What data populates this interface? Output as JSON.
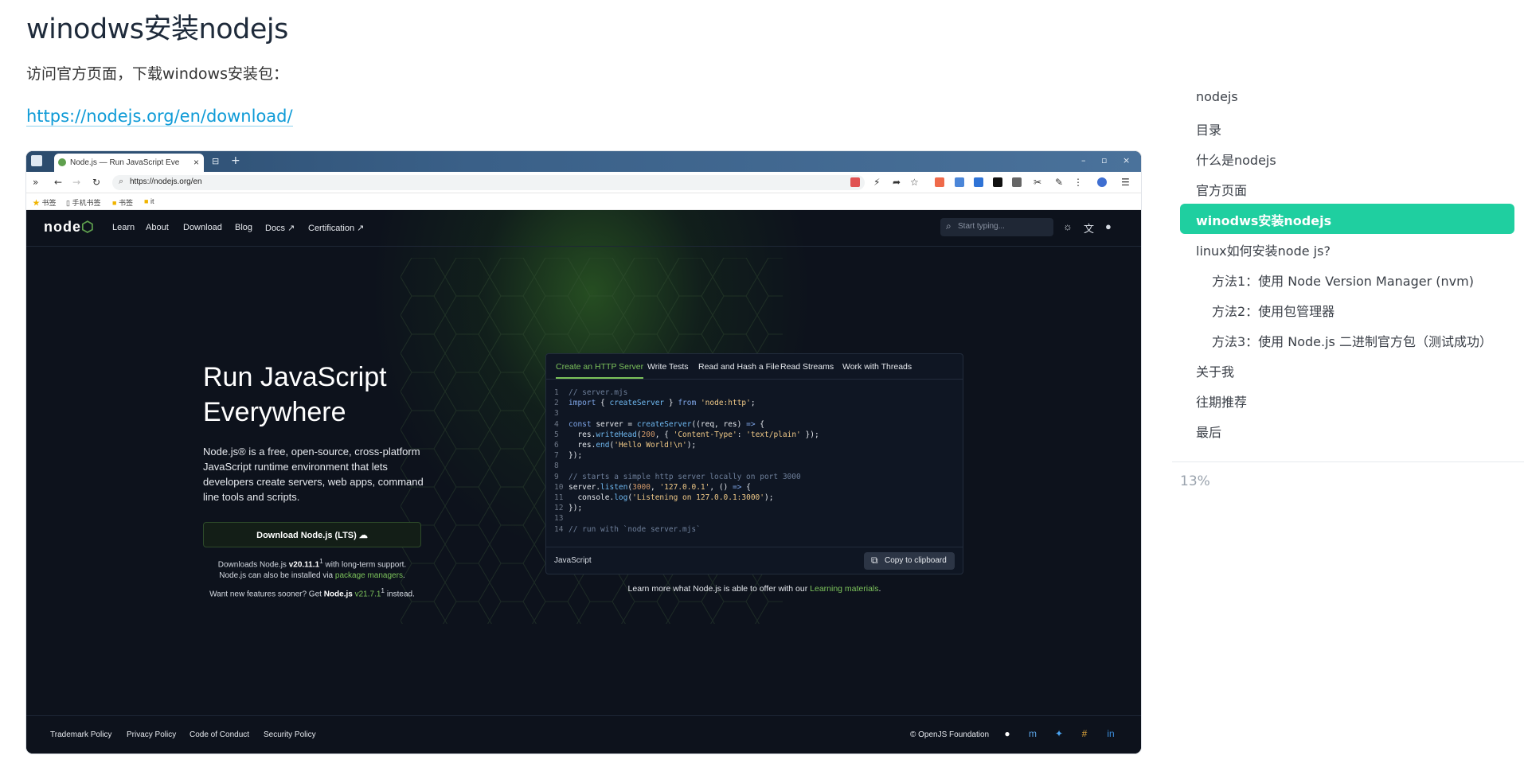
{
  "article": {
    "heading": "winodws安装nodejs",
    "intro": "访问官方页面，下载windows安装包：",
    "link": "https://nodejs.org/en/download/"
  },
  "browser": {
    "tab_title": "Node.js — Run JavaScript Eve",
    "url": "https://nodejs.org/en",
    "bookmarks": [
      "书签",
      "手机书签",
      "书签",
      "it"
    ]
  },
  "site": {
    "logo": "node",
    "nav": [
      "Learn",
      "About",
      "Download",
      "Blog",
      "Docs ↗",
      "Certification ↗"
    ],
    "search_placeholder": "Start typing...",
    "hero": {
      "title_line1": "Run JavaScript",
      "title_line2": "Everywhere",
      "description": "Node.js® is a free, open-source, cross-platform JavaScript runtime environment that lets developers create servers, web apps, command line tools and scripts.",
      "download_button": "Download Node.js (LTS)",
      "lts_prefix": "Downloads Node.js ",
      "lts_version": "v20.11.1",
      "lts_suffix": " with long-term support.",
      "pkg_prefix": "Node.js can also be installed via ",
      "pkg_link": "package managers",
      "pkg_suffix": ".",
      "current_prefix": "Want new features sooner? Get ",
      "current_name": "Node.js",
      "current_version": "v21.7.1",
      "current_suffix": " instead."
    },
    "code_tabs": [
      "Create an HTTP Server",
      "Write Tests",
      "Read and Hash a File",
      "Read Streams",
      "Work with Threads"
    ],
    "code_language": "JavaScript",
    "copy_label": "Copy to clipboard",
    "learn_prefix": "Learn more what Node.js is able to offer with our ",
    "learn_link": "Learning materials",
    "learn_suffix": ".",
    "footer_links": [
      "Trademark Policy",
      "Privacy Policy",
      "Code of Conduct",
      "Security Policy"
    ],
    "copyright": "© OpenJS Foundation"
  },
  "toc": {
    "items": [
      {
        "label": "nodejs"
      },
      {
        "label": "目录"
      },
      {
        "label": "什么是nodejs"
      },
      {
        "label": "官方页面"
      },
      {
        "label": "winodws安装nodejs"
      },
      {
        "label": "linux如何安装node js?"
      },
      {
        "label": "方法1：使用 Node Version Manager (nvm)"
      },
      {
        "label": "方法2：使用包管理器"
      },
      {
        "label": "方法3：使用 Node.js 二进制官方包（测试成功）"
      },
      {
        "label": "关于我"
      },
      {
        "label": "往期推荐"
      },
      {
        "label": "最后"
      }
    ],
    "active_index": 4,
    "progress": "13%"
  },
  "colors": {
    "toc_active": "#1fcfa0",
    "link": "#0f9bd7",
    "node_green": "#5fa04e"
  }
}
